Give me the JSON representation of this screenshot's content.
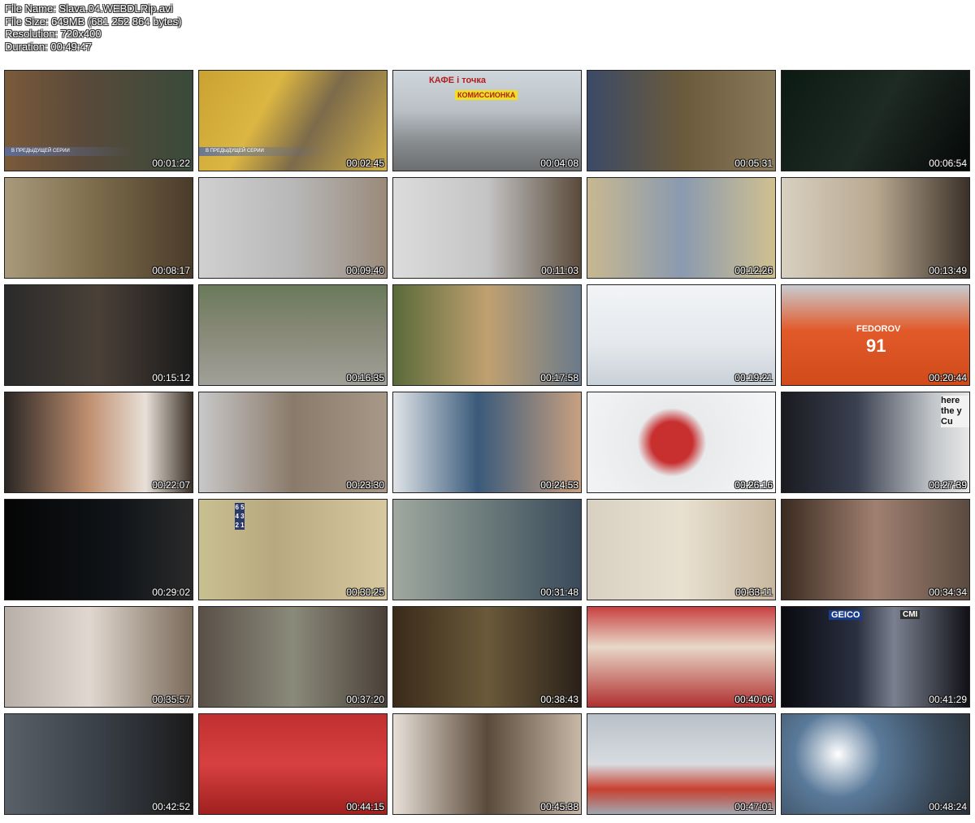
{
  "meta": {
    "file_name": "File Name: Slava.04.WEBDLRip.avi",
    "file_size": "File Size: 649MB (681 252 864 bytes)",
    "resolution": "Resolution: 720x400",
    "duration": "Duration: 00:49:47"
  },
  "thumbnails": [
    {
      "time": "00:01:22",
      "caption": "В ПРЕДЫДУЩЕЙ СЕРИИ",
      "bg": "linear-gradient(90deg,#7a5a3a 0%,#5a4a3a 40%,#3a4a3a 100%)"
    },
    {
      "time": "00:02:45",
      "caption": "В ПРЕДЫДУЩЕЙ СЕРИИ",
      "bg": "linear-gradient(120deg,#c9a232 0%,#dcb642 35%,#7c6a4a 60%,#d2b04a 100%)"
    },
    {
      "time": "00:04:08",
      "sign1": "КАФЕ   i точка",
      "sign2": "КОМИССИОНКА",
      "bg": "linear-gradient(180deg,#cfd6dc 0%,#b9c0c6 40%,#8a8e90 70%,#6c6e70 100%)"
    },
    {
      "time": "00:05:31",
      "bg": "linear-gradient(90deg,#3b4a66 0%,#6a5a3c 50%,#8a7a5a 100%)"
    },
    {
      "time": "00:06:54",
      "bg": "linear-gradient(120deg,#0c1a14 0%,#1e2a24 50%,#050807 100%)"
    },
    {
      "time": "00:08:17",
      "bg": "linear-gradient(90deg,#a89a7a 0%,#7a6a4a 50%,#4a3a2a 100%)"
    },
    {
      "time": "00:09:40",
      "bg": "linear-gradient(90deg,#d0d0d0 0%,#b8b8b8 50%,#9a8a7a 100%)"
    },
    {
      "time": "00:11:03",
      "bg": "linear-gradient(90deg,#dcdcdc 0%,#c4c4c4 50%,#5a4a3a 100%)"
    },
    {
      "time": "00:12:26",
      "bg": "linear-gradient(90deg,#c8b890 0%,#8a9ab0 50%,#d0c090 100%)"
    },
    {
      "time": "00:13:49",
      "bg": "linear-gradient(90deg,#d8d0c0 0%,#b8a890 50%,#3a3028 100%)"
    },
    {
      "time": "00:15:12",
      "bg": "linear-gradient(90deg,#2a2a2a 0%,#4a4038 50%,#1a1a1a 100%)"
    },
    {
      "time": "00:16:35",
      "bg": "linear-gradient(180deg,#6a7a5a 0%,#8a8a7a 50%,#a0a098 100%)"
    },
    {
      "time": "00:17:58",
      "bg": "linear-gradient(90deg,#5a6a3a 0%,#c0a070 50%,#6a7a8a 100%)"
    },
    {
      "time": "00:19:21",
      "bg": "linear-gradient(180deg,#f2f4f6 0%,#e4e8ec 60%,#c8d0d8 100%)"
    },
    {
      "time": "00:20:44",
      "sign1": "FEDOROV",
      "sign2": "91",
      "bg": "linear-gradient(180deg,#c8ccd0 0%,#e25a2a 45%,#d04a1a 100%)"
    },
    {
      "time": "00:22:07",
      "bg": "linear-gradient(90deg,#2a2624 0%,#c09070 45%,#e8e0d8 75%,#3a3028 100%)"
    },
    {
      "time": "00:23:30",
      "bg": "linear-gradient(90deg,#c8c8c8 0%,#8a7a6a 50%,#a89888 100%)"
    },
    {
      "time": "00:24:53",
      "bg": "linear-gradient(90deg,#e0e4e8 0%,#3a5a7a 45%,#c8a080 100%)"
    },
    {
      "time": "00:26:16",
      "bg": "radial-gradient(circle at 45% 50%,#c83030 0%,#c83030 18%,#e8eaec 30%,#f4f6f8 100%)"
    },
    {
      "time": "00:27:39",
      "sign1": "here the y Cu",
      "bg": "linear-gradient(90deg,#1a1a20 0%,#3a4050 40%,#c0c4c8 80%,#e8e8e8 100%)"
    },
    {
      "time": "00:29:02",
      "bg": "linear-gradient(90deg,#050505 0%,#101418 60%,#2a2a2a 100%)"
    },
    {
      "time": "00:30:25",
      "sign1": "6 5 4 3 2 1",
      "bg": "linear-gradient(90deg,#c8c090 0%,#b8a880 40%,#d8c8a0 100%)"
    },
    {
      "time": "00:31:48",
      "bg": "linear-gradient(90deg,#a0a8a0 0%,#6a7a7a 50%,#3a4a5a 100%)"
    },
    {
      "time": "00:33:11",
      "bg": "linear-gradient(90deg,#d8d0c0 0%,#e8e0d0 50%,#c8b8a0 100%)"
    },
    {
      "time": "00:34:34",
      "bg": "linear-gradient(90deg,#3a2a20 0%,#a08070 50%,#5a4a40 100%)"
    },
    {
      "time": "00:35:57",
      "bg": "linear-gradient(90deg,#b8b0a8 0%,#e0d8d0 45%,#7a6a5a 100%)"
    },
    {
      "time": "00:37:20",
      "bg": "linear-gradient(90deg,#5a5048 0%,#8a8a7a 50%,#4a4038 100%)"
    },
    {
      "time": "00:38:43",
      "bg": "linear-gradient(90deg,#3a2a1a 0%,#6a5a3a 50%,#2a2018 100%)"
    },
    {
      "time": "00:40:06",
      "bg": "linear-gradient(180deg,#c84040 0%,#e8d8c8 40%,#b03030 100%)"
    },
    {
      "time": "00:41:29",
      "sign1": "GEICO",
      "sign2": "CMI",
      "bg": "linear-gradient(90deg,#0a0a10 0%,#2a3040 40%,#7a8090 60%,#101015 100%)"
    },
    {
      "time": "00:42:52",
      "bg": "linear-gradient(90deg,#5a6068 0%,#3a4048 50%,#1a1a1a 100%)"
    },
    {
      "time": "00:44:15",
      "bg": "linear-gradient(180deg,#c03030 0%,#d84040 50%,#a02020 100%)"
    },
    {
      "time": "00:45:38",
      "bg": "linear-gradient(90deg,#e8e0d8 0%,#5a4a3a 50%,#c8b8a8 100%)"
    },
    {
      "time": "00:47:01",
      "bg": "linear-gradient(180deg,#b8c0c8 0%,#d8dce0 50%,#c84030 75%,#a0a8b0 100%)"
    },
    {
      "time": "00:48:24",
      "bg": "radial-gradient(circle at 30% 40%,#ffffff 0%,#5a7a9a 30%,#3a4a5a 70%,#2a3038 100%)"
    }
  ]
}
